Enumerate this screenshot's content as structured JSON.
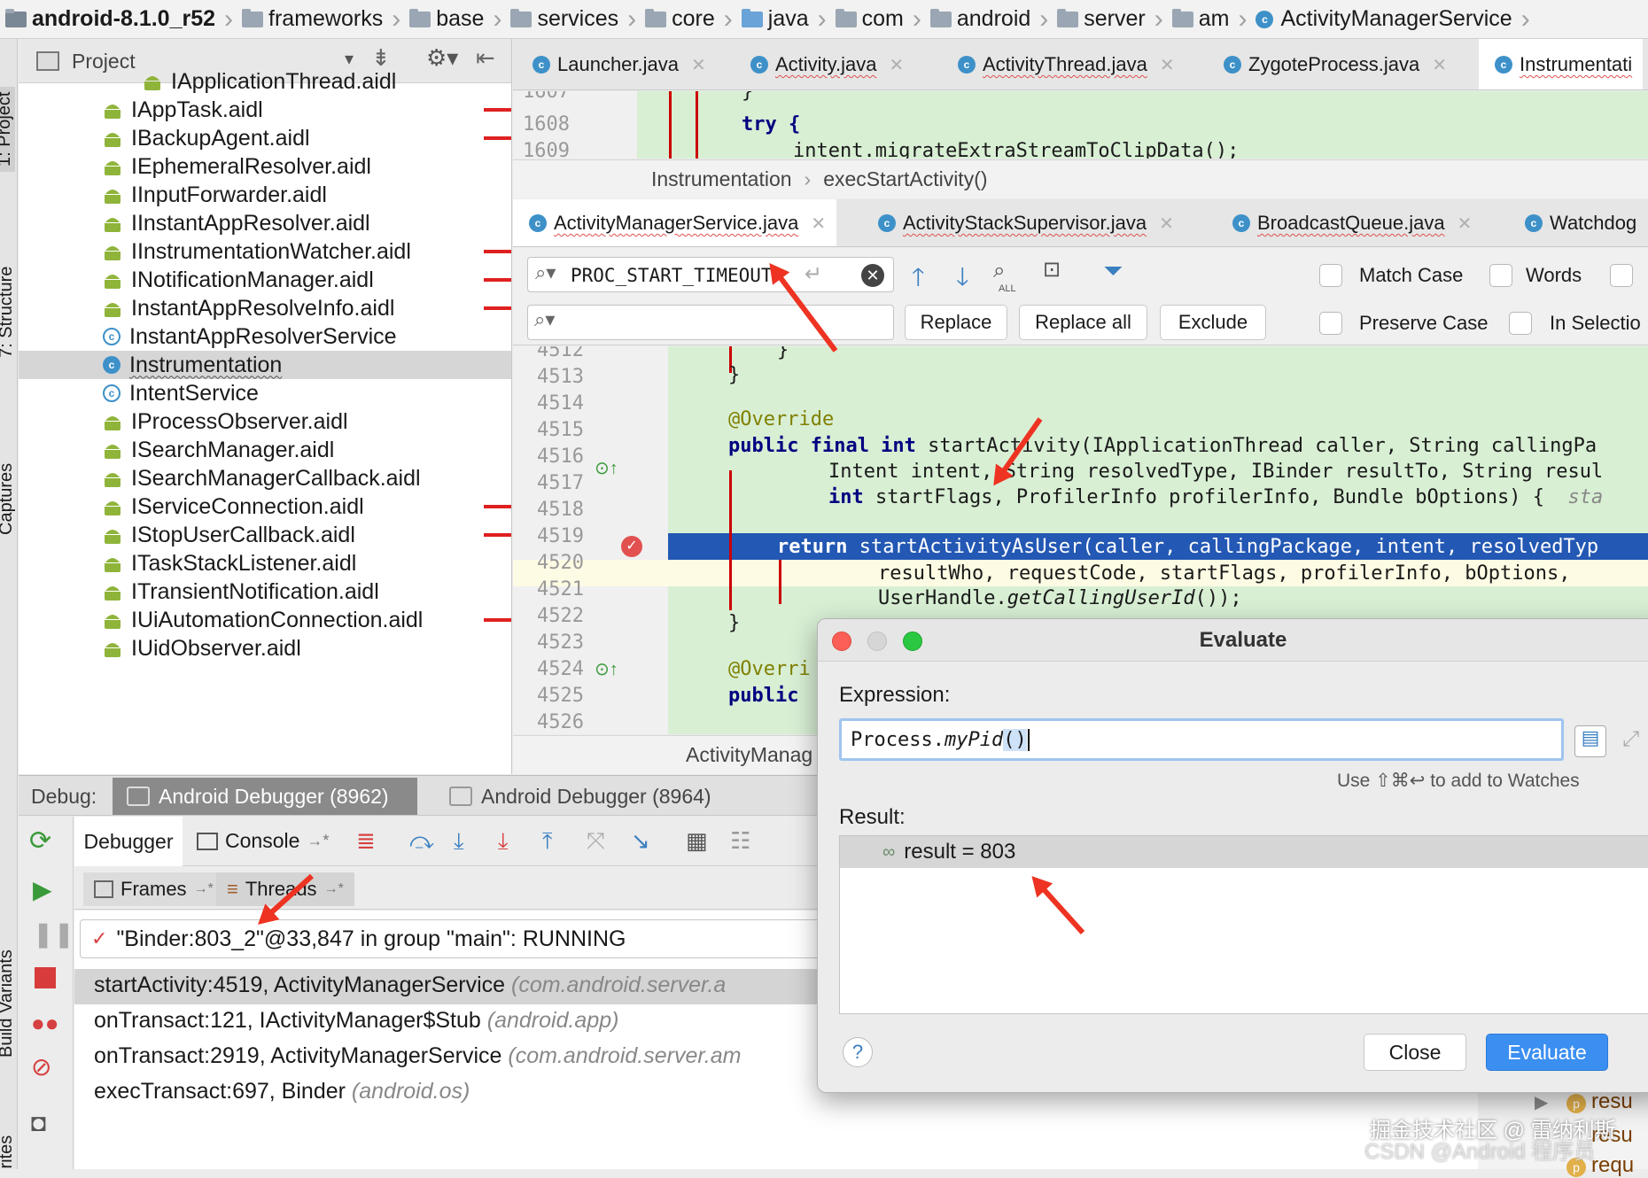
{
  "breadcrumb": [
    "android-8.1.0_r52",
    "frameworks",
    "base",
    "services",
    "core",
    "java",
    "com",
    "android",
    "server",
    "am",
    "ActivityManagerService"
  ],
  "project_panel": {
    "title": "Project",
    "partial_top": "IApplicationThread.aidl",
    "items": [
      {
        "label": "IAppTask.aidl",
        "icon": "android-icon"
      },
      {
        "label": "IBackupAgent.aidl",
        "icon": "android-icon"
      },
      {
        "label": "IEphemeralResolver.aidl",
        "icon": "android-icon"
      },
      {
        "label": "IInputForwarder.aidl",
        "icon": "android-icon"
      },
      {
        "label": "IInstantAppResolver.aidl",
        "icon": "android-icon"
      },
      {
        "label": "IInstrumentationWatcher.aidl",
        "icon": "android-icon"
      },
      {
        "label": "INotificationManager.aidl",
        "icon": "android-icon"
      },
      {
        "label": "InstantAppResolveInfo.aidl",
        "icon": "android-icon"
      },
      {
        "label": "InstantAppResolverService",
        "icon": "class-icon"
      },
      {
        "label": "Instrumentation",
        "icon": "class-icon",
        "selected": true
      },
      {
        "label": "IntentService",
        "icon": "class-icon"
      },
      {
        "label": "IProcessObserver.aidl",
        "icon": "android-icon"
      },
      {
        "label": "ISearchManager.aidl",
        "icon": "android-icon"
      },
      {
        "label": "ISearchManagerCallback.aidl",
        "icon": "android-icon"
      },
      {
        "label": "IServiceConnection.aidl",
        "icon": "android-icon"
      },
      {
        "label": "IStopUserCallback.aidl",
        "icon": "android-icon"
      },
      {
        "label": "ITaskStackListener.aidl",
        "icon": "android-icon"
      },
      {
        "label": "ITransientNotification.aidl",
        "icon": "android-icon"
      },
      {
        "label": "IUiAutomationConnection.aidl",
        "icon": "android-icon"
      },
      {
        "label": "IUidObserver.aidl",
        "icon": "android-icon"
      }
    ]
  },
  "side_tabs": [
    "1: Project",
    "7: Structure",
    "Captures",
    "Build Variants",
    "Favorites"
  ],
  "top_tabs": [
    "Launcher.java",
    "Activity.java",
    "ActivityThread.java",
    "ZygoteProcess.java",
    "Instrumentati"
  ],
  "top_editor": {
    "lines": [
      "1607",
      "1608",
      "1609"
    ],
    "code": [
      "}",
      "try {",
      "intent.migrateExtraStreamToClipData();"
    ],
    "crumbs": [
      "Instrumentation",
      "execStartActivity()"
    ]
  },
  "second_tabs": [
    "ActivityManagerService.java",
    "ActivityStackSupervisor.java",
    "BroadcastQueue.java",
    "Watchdog"
  ],
  "find": {
    "search_value": "PROC_START_TIMEOUT",
    "replace_value": "",
    "replace": "Replace",
    "replace_all": "Replace all",
    "exclude": "Exclude",
    "match_case": "Match Case",
    "words": "Words",
    "preserve_case": "Preserve Case",
    "in_selection": "In Selectio",
    "all_badge": "ALL"
  },
  "main_editor": {
    "lines": [
      "4512",
      "4513",
      "4514",
      "4515",
      "4516",
      "4517",
      "4518",
      "4519",
      "4520",
      "4521",
      "4522",
      "4523",
      "4524",
      "4525",
      "4526"
    ],
    "code": {
      "l4512": "}",
      "l4513": "}",
      "l4515": "@Override",
      "l4516_kw": "public final int",
      "l4516_rest": " startActivity(IApplicationThread caller, String callingPa",
      "l4517": "Intent intent, String resolvedType, IBinder resultTo, String resul",
      "l4518_kw": "int",
      "l4518_rest": " startFlags, ProfilerInfo profilerInfo, Bundle bOptions) {",
      "l4518_hint": "sta",
      "l4519_kw": "return",
      "l4519_rest": " startActivityAsUser(caller, callingPackage, intent, resolvedTyp",
      "l4520": "resultWho, requestCode, startFlags, profilerInfo, bOptions,",
      "l4521_a": "UserHandle.",
      "l4521_b": "getCallingUserId",
      "l4521_c": "());",
      "l4522": "}",
      "l4524": "@Overri",
      "l4525": "public"
    },
    "status_crumb": "ActivityManag"
  },
  "debug": {
    "label": "Debug:",
    "sessions": [
      "Android Debugger (8962)",
      "Android Debugger (8964)"
    ],
    "tabs": [
      "Debugger",
      "Console"
    ],
    "subtabs": [
      "Frames",
      "Threads"
    ],
    "thread": "\"Binder:803_2\"@33,847 in group \"main\": RUNNING",
    "frames": [
      {
        "method": "startActivity:4519, ActivityManagerService",
        "pkg": "(com.android.server.a"
      },
      {
        "method": "onTransact:121, IActivityManager$Stub",
        "pkg": "(android.app)"
      },
      {
        "method": "onTransact:2919, ActivityManagerService",
        "pkg": "(com.android.server.am"
      },
      {
        "method": "execTransact:697, Binder",
        "pkg": "(android.os)"
      }
    ]
  },
  "evaluate": {
    "title": "Evaluate",
    "expression_label": "Expression:",
    "expression_plain": "Process.",
    "expression_call": "myPid",
    "expression_paren": "()",
    "hint": "Use ⇧⌘↩ to add to Watches",
    "result_label": "Result:",
    "result": "result = 803",
    "help": "?",
    "close": "Close",
    "evaluate": "Evaluate"
  },
  "watches": [
    "resu",
    "resu",
    "requ"
  ],
  "watermark": "掘金技术社区 @ 雷纳利斯",
  "watermark2": "CSDN @Android 程序员"
}
